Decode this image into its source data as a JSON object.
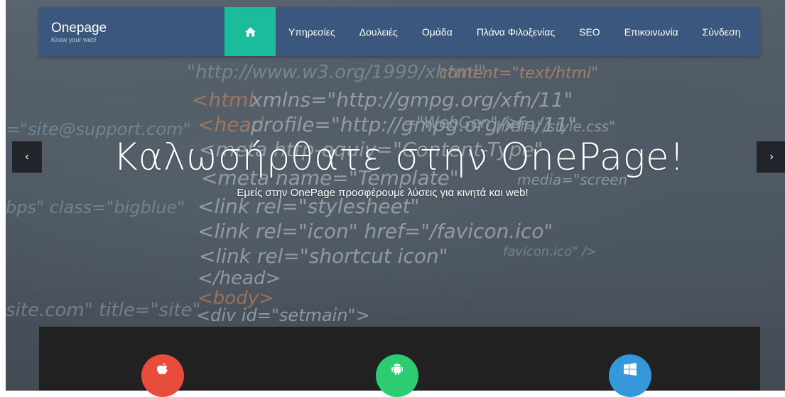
{
  "brand": {
    "name": "Onepage",
    "tagline": "Know your web!"
  },
  "nav": {
    "home_icon": "home-icon",
    "items": [
      {
        "label": "Υπηρεσίες"
      },
      {
        "label": "Δουλειές"
      },
      {
        "label": "Ομάδα"
      },
      {
        "label": "Πλάνα Φιλοξενίας"
      },
      {
        "label": "SEO"
      },
      {
        "label": "Επικοινωνία"
      },
      {
        "label": "Σύνδεση"
      }
    ]
  },
  "hero": {
    "title": "Καλωσήρθατε στην OnePage!",
    "subtitle": "Εμείς στην OnePage προσφέρουμε λύσεις για κινητά και web!",
    "prev_icon": "chevron-left-icon",
    "next_icon": "chevron-right-icon",
    "prev_glyph": "‹",
    "next_glyph": "›"
  },
  "platforms": [
    {
      "icon": "apple-icon",
      "color": "#e74c3c"
    },
    {
      "icon": "android-icon",
      "color": "#2ecc71"
    },
    {
      "icon": "windows-icon",
      "color": "#3498db"
    }
  ],
  "colors": {
    "navbar": "#3b577d",
    "accent": "#1bbc9b",
    "panel": "#212121"
  }
}
